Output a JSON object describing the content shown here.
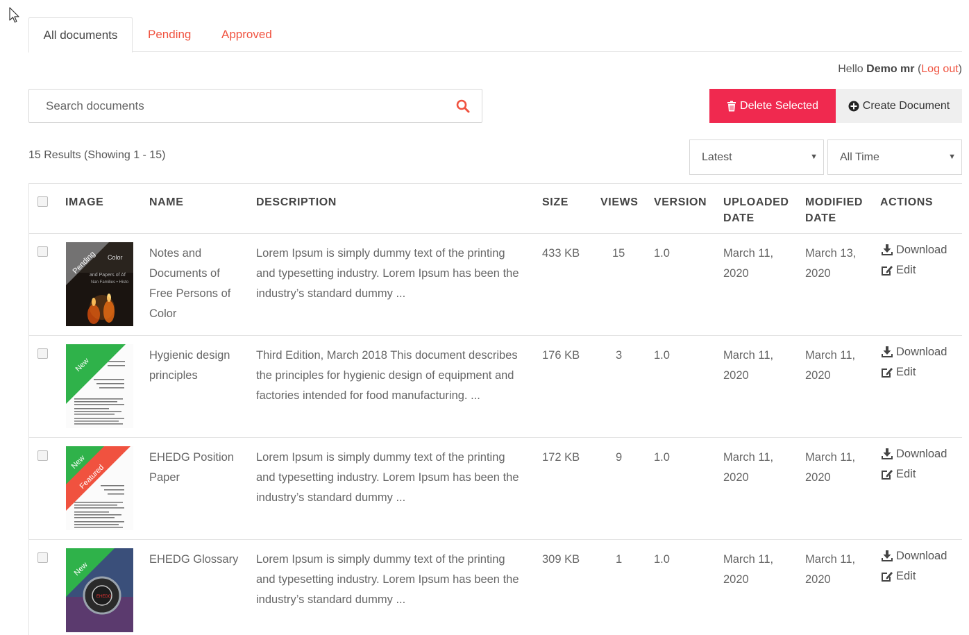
{
  "tabs": [
    {
      "label": "All documents",
      "active": true
    },
    {
      "label": "Pending",
      "active": false
    },
    {
      "label": "Approved",
      "active": false
    }
  ],
  "greeting": {
    "prefix": "Hello ",
    "user": "Demo mr",
    "open_paren": " (",
    "logout": "Log out",
    "close_paren": ")"
  },
  "search": {
    "placeholder": "Search documents"
  },
  "buttons": {
    "delete": "Delete Selected",
    "create": "Create Document"
  },
  "results_text": "15 Results (Showing 1 - 15)",
  "filters": {
    "sort": "Latest",
    "time": "All Time"
  },
  "table": {
    "headers": {
      "image": "IMAGE",
      "name": "NAME",
      "description": "DESCRIPTION",
      "size": "SIZE",
      "views": "VIEWS",
      "version": "VERSION",
      "uploaded_1": "UPLOADED",
      "uploaded_2": "DATE",
      "modified_1": "MODIFIED",
      "modified_2": "DATE",
      "actions": "ACTIONS"
    },
    "rows": [
      {
        "name": "Notes and Documents of Free Persons of Color",
        "description": "Lorem Ipsum is simply dummy text of the printing and typesetting industry. Lorem Ipsum has been the industry’s standard dummy ...",
        "size": "433 KB",
        "views": "15",
        "version": "1.0",
        "uploaded_1": "March 11,",
        "uploaded_2": "2020",
        "modified_1": "March 13,",
        "modified_2": "2020",
        "ribbons": [
          "Pending"
        ],
        "thumb_text_1": "Color",
        "thumb_text_2": "and Papers of Af",
        "thumb_text_3": "Nan Families • Histo"
      },
      {
        "name": "Hygienic design principles",
        "description": "Third Edition, March 2018 This document describes the principles for hygienic design of equipment and factories intended for food manufacturing. ...",
        "size": "176 KB",
        "views": "3",
        "version": "1.0",
        "uploaded_1": "March 11,",
        "uploaded_2": "2020",
        "modified_1": "March 11,",
        "modified_2": "2020",
        "ribbons": [
          "New"
        ]
      },
      {
        "name": "EHEDG Position Paper",
        "description": "Lorem Ipsum is simply dummy text of the printing and typesetting industry. Lorem Ipsum has been the industry’s standard dummy ...",
        "size": "172 KB",
        "views": "9",
        "version": "1.0",
        "uploaded_1": "March 11,",
        "uploaded_2": "2020",
        "modified_1": "March 11,",
        "modified_2": "2020",
        "ribbons": [
          "New",
          "Featured"
        ]
      },
      {
        "name": "EHEDG Glossary",
        "description": "Lorem Ipsum is simply dummy text of the printing and typesetting industry. Lorem Ipsum has been the industry’s standard dummy ...",
        "size": "309 KB",
        "views": "1",
        "version": "1.0",
        "uploaded_1": "March 11,",
        "uploaded_2": "2020",
        "modified_1": "March 11,",
        "modified_2": "2020",
        "ribbons": [
          "New"
        ],
        "thumb_text_1": "EHEDG"
      }
    ],
    "actions": {
      "download": "Download",
      "edit": "Edit"
    }
  },
  "colors": {
    "accent": "#f0523f",
    "delete_bg": "#f0294f",
    "ribbon_pending": "#7a7a7a",
    "ribbon_new": "#2fb24a",
    "ribbon_featured": "#f0523f"
  },
  "icons": {
    "cursor": "cursor-arrow-icon",
    "search": "search-icon",
    "delete": "trash-icon",
    "create": "plus-circle-icon",
    "download": "download-icon",
    "edit": "edit-icon"
  }
}
